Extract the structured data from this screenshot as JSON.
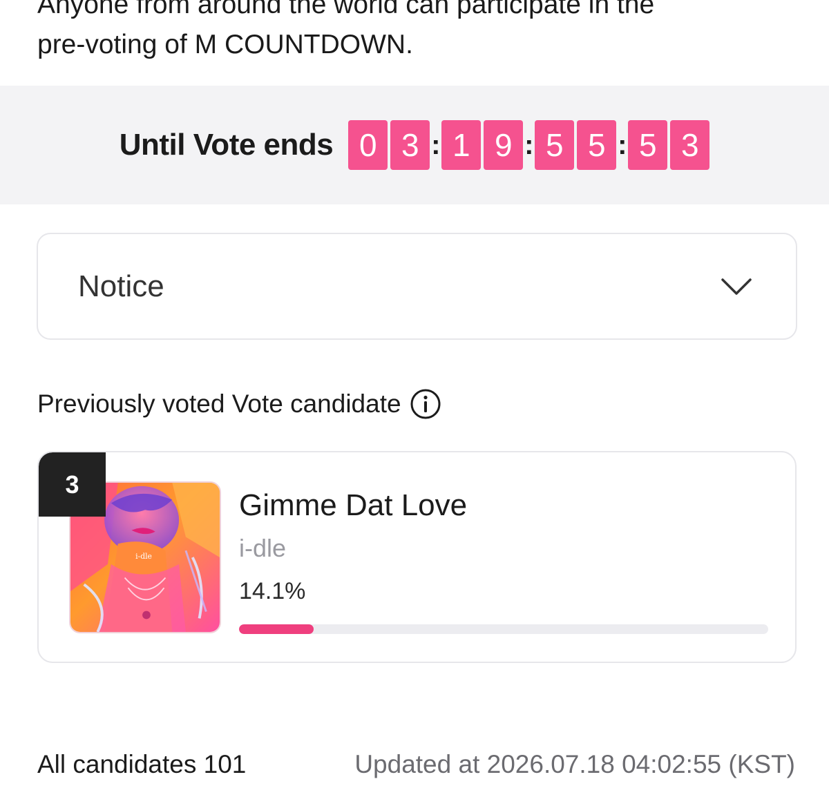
{
  "intro": {
    "line1": "Anyone from around the world can participate in the",
    "line2": "pre-voting of M COUNTDOWN."
  },
  "countdown": {
    "label": "Until Vote ends",
    "digits": [
      "0",
      "3",
      "1",
      "9",
      "5",
      "5",
      "5",
      "3"
    ],
    "separator": ":"
  },
  "notice": {
    "label": "Notice",
    "icon": "chevron-down-icon"
  },
  "previous": {
    "heading": "Previously voted Vote candidate",
    "icon": "info-icon"
  },
  "candidate": {
    "rank": "3",
    "title": "Gimme Dat Love",
    "artist": "i-dle",
    "percent_label": "14.1%",
    "percent": 14.1,
    "album_text": "i-dle",
    "accent": "#ef3f7e"
  },
  "footer": {
    "all_candidates": "All candidates 101",
    "updated": "Updated at 2026.07.18 04:02:55 (KST)"
  },
  "colors": {
    "timer_digit": "#f5528f",
    "progress_fill": "#ef3f7e",
    "band_bg": "#f3f3f5"
  }
}
